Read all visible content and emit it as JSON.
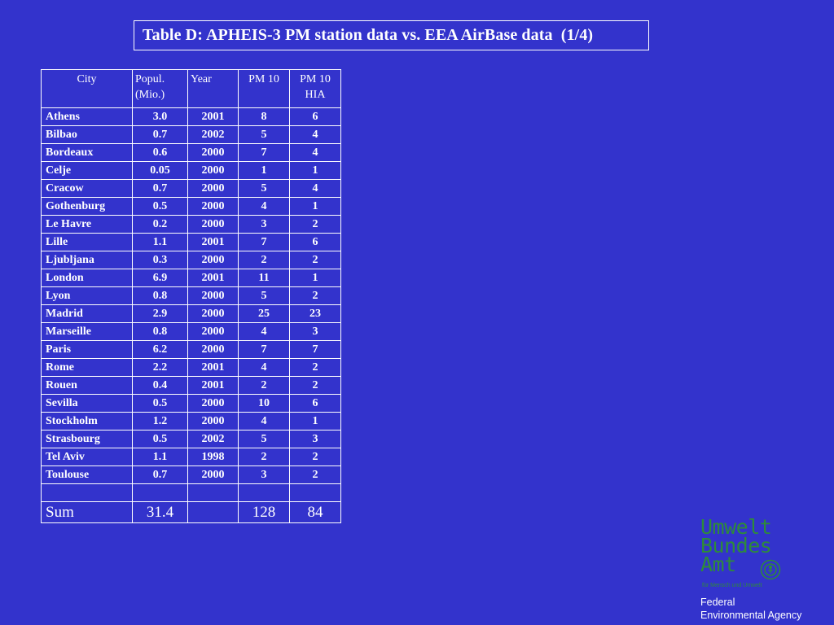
{
  "title": "Table D: APHEIS-3 PM station data vs. EEA AirBase data  (1/4)",
  "table": {
    "headers": {
      "city": "City",
      "population_line1": "Popul.",
      "population_line2": "(Mio.)",
      "year": "Year",
      "pm10": "PM 10",
      "pm10_hia_line1": "PM 10",
      "pm10_hia_line2": "HIA"
    },
    "rows": [
      [
        "Athens",
        "3.0",
        "2001",
        "8",
        "6"
      ],
      [
        "Bilbao",
        "0.7",
        "2002",
        "5",
        "4"
      ],
      [
        "Bordeaux",
        "0.6",
        "2000",
        "7",
        "4"
      ],
      [
        "Celje",
        "0.05",
        "2000",
        "1",
        "1"
      ],
      [
        "Cracow",
        "0.7",
        "2000",
        "5",
        "4"
      ],
      [
        "Gothenburg",
        "0.5",
        "2000",
        "4",
        "1"
      ],
      [
        "Le Havre",
        "0.2",
        "2000",
        "3",
        "2"
      ],
      [
        "Lille",
        "1.1",
        "2001",
        "7",
        "6"
      ],
      [
        "Ljubljana",
        "0.3",
        "2000",
        "2",
        "2"
      ],
      [
        "London",
        "6.9",
        "2001",
        "11",
        "1"
      ],
      [
        "Lyon",
        "0.8",
        "2000",
        "5",
        "2"
      ],
      [
        "Madrid",
        "2.9",
        "2000",
        "25",
        "23"
      ],
      [
        "Marseille",
        "0.8",
        "2000",
        "4",
        "3"
      ],
      [
        "Paris",
        "6.2",
        "2000",
        "7",
        "7"
      ],
      [
        "Rome",
        "2.2",
        "2001",
        "4",
        "2"
      ],
      [
        "Rouen",
        "0.4",
        "2001",
        "2",
        "2"
      ],
      [
        "Sevilla",
        "0.5",
        "2000",
        "10",
        "6"
      ],
      [
        "Stockholm",
        "1.2",
        "2000",
        "4",
        "1"
      ],
      [
        "Strasbourg",
        "0.5",
        "2002",
        "5",
        "3"
      ],
      [
        "Tel Aviv",
        "1.1",
        "1998",
        "2",
        "2"
      ],
      [
        "Toulouse",
        "0.7",
        "2000",
        "3",
        "2"
      ]
    ],
    "sum": {
      "label": "Sum",
      "population": "31.4",
      "year": "",
      "pm10": "128",
      "pm10_hia": "84"
    }
  },
  "logo": {
    "line1": "Umwelt",
    "line2": "Bundes",
    "line3": "Amt",
    "subtitle": "für Mensch und Umwelt",
    "color": "#2e8b3a"
  },
  "agency": {
    "line1": "Federal",
    "line2": "Environmental Agency"
  },
  "colors": {
    "background": "#3333cc",
    "text": "#ffffff"
  }
}
